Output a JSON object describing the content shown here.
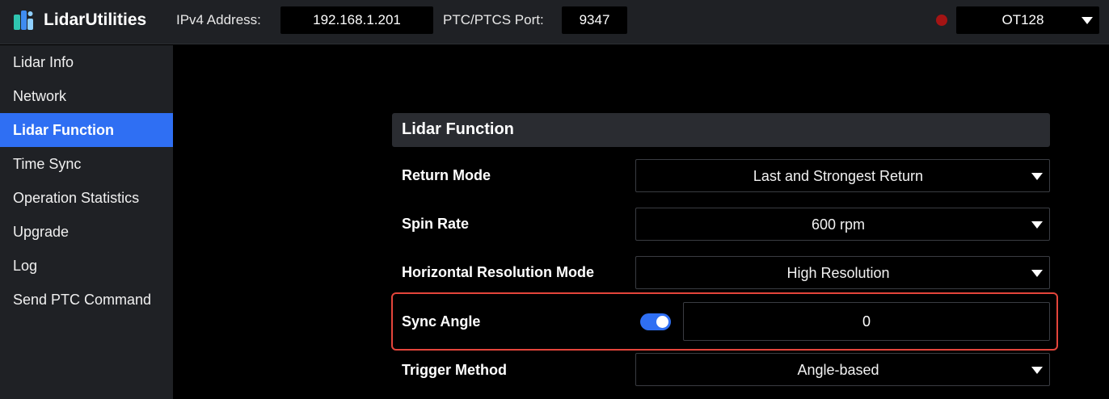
{
  "app": {
    "title": "LidarUtilities"
  },
  "connection": {
    "ipv4_label": "IPv4 Address:",
    "ipv4_value": "192.168.1.201",
    "port_label": "PTC/PTCS Port:",
    "port_value": "9347",
    "status_color": "#a41414",
    "model": "OT128"
  },
  "sidebar": {
    "items": [
      {
        "label": "Lidar Info"
      },
      {
        "label": "Network"
      },
      {
        "label": "Lidar Function",
        "active": true
      },
      {
        "label": "Time Sync"
      },
      {
        "label": "Operation Statistics"
      },
      {
        "label": "Upgrade"
      },
      {
        "label": "Log"
      },
      {
        "label": "Send PTC Command"
      }
    ]
  },
  "panel": {
    "title": "Lidar Function",
    "return_mode": {
      "label": "Return Mode",
      "value": "Last and Strongest Return"
    },
    "spin_rate": {
      "label": "Spin Rate",
      "value": "600 rpm"
    },
    "horizontal_resolution": {
      "label": "Horizontal Resolution Mode",
      "value": "High Resolution"
    },
    "sync_angle": {
      "label": "Sync Angle",
      "enabled": true,
      "value": "0"
    },
    "trigger_method": {
      "label": "Trigger Method",
      "value": "Angle-based"
    }
  },
  "colors": {
    "accent": "#2f6ff3",
    "highlight_border": "#e4453b"
  }
}
